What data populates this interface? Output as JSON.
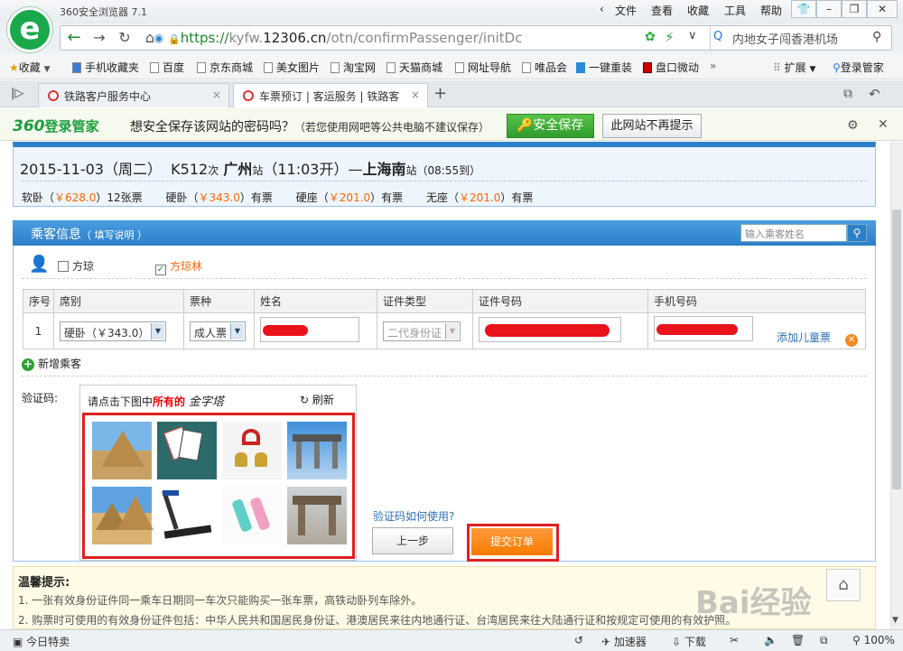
{
  "browser": {
    "title": "360安全浏览器 7.1",
    "menus": [
      "文件",
      "查看",
      "收藏",
      "工具",
      "帮助"
    ],
    "url_scheme": "https://",
    "url_pre": "kyfw.",
    "url_domain": "12306.cn",
    "url_path": "/otn/confirmPassenger/initDc",
    "search_text": "内地女子闯香港机场",
    "bookmarks": [
      "收藏",
      "手机收藏夹",
      "百度",
      "京东商城",
      "美女图片",
      "淘宝网",
      "天猫商城",
      "网址导航",
      "唯品会",
      "一键重装",
      "盘口微动"
    ],
    "bookmark_more": "»",
    "extensions_label": "扩展",
    "login_label": "登录管家",
    "tabs": [
      {
        "label": "铁路客户服务中心"
      },
      {
        "label": "车票预订 | 客运服务 | 铁路客"
      }
    ],
    "accent": "#1a8a2a"
  },
  "password_bar": {
    "logo_num": "360",
    "logo_text": "登录管家",
    "message": "想安全保存该网站的密码吗？",
    "message_note": "（若您使用网吧等公共电脑不建议保存）",
    "save_label": "安全保存",
    "never_label": "此网站不再提示"
  },
  "train": {
    "date": "2015-11-03",
    "weekday": "（周二）",
    "train_no": "K512",
    "train_suffix": "次",
    "from": "广州",
    "from_suffix": "站",
    "depart": "（11:03开）",
    "dash": "—",
    "to": "上海南",
    "to_suffix": "站",
    "arrive": "（08:55到）",
    "prices": [
      {
        "seat": "软卧",
        "price": "￥628.0",
        "avail": "12张票"
      },
      {
        "seat": "硬卧",
        "price": "￥343.0",
        "avail": "有票"
      },
      {
        "seat": "硬座",
        "price": "￥201.0",
        "avail": "有票"
      },
      {
        "seat": "无座",
        "price": "￥201.0",
        "avail": "有票"
      }
    ]
  },
  "passengers": {
    "title": "乘客信息",
    "title_note": "（ 填写说明 ）",
    "search_placeholder": "输入乘客姓名",
    "candidates": [
      {
        "name": "方琼",
        "checked": false
      },
      {
        "name": "方琼林",
        "checked": true
      }
    ],
    "columns": [
      "序号",
      "席别",
      "票种",
      "姓名",
      "证件类型",
      "证件号码",
      "手机号码"
    ],
    "row": {
      "index": "1",
      "seat": "硬卧（￥343.0）",
      "ticket_type": "成人票",
      "id_type": "二代身份证",
      "add_child": "添加儿童票"
    },
    "add_passenger": "新增乘客"
  },
  "captcha": {
    "label": "验证码:",
    "prompt_pre": "请点击下图中",
    "prompt_key": "所有的",
    "keyword": "金字塔",
    "refresh": "刷新",
    "help": "验证码如何使用?",
    "images": [
      "pyramid",
      "playing-cards",
      "bells",
      "archway",
      "pyramids",
      "treadmill",
      "thermos",
      "archway"
    ]
  },
  "actions": {
    "prev": "上一步",
    "submit": "提交订单"
  },
  "tips": {
    "title": "温馨提示:",
    "lines": [
      "1. 一张有效身份证件同一乘车日期同一车次只能购买一张车票，高铁动卧列车除外。",
      "2. 购票时可使用的有效身份证件包括：中华人民共和国居民身份证、港澳居民来往内地通行证、台湾居民来往大陆通行证和按规定可使用的有效护照。"
    ]
  },
  "watermark": "Bai经验",
  "statusbar": {
    "left": "今日特卖",
    "speed": "加速器",
    "download": "下载",
    "zoom": "100%"
  }
}
